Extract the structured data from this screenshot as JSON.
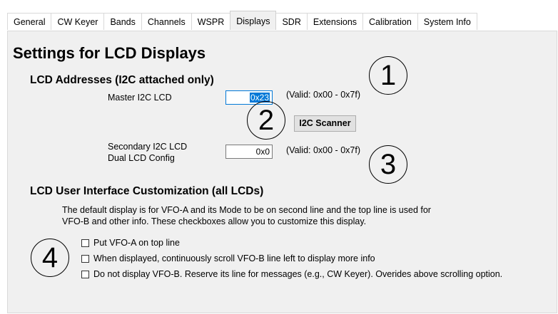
{
  "tabs": [
    "General",
    "CW Keyer",
    "Bands",
    "Channels",
    "WSPR",
    "Displays",
    "SDR",
    "Extensions",
    "Calibration",
    "System Info"
  ],
  "active_tab": "Displays",
  "page_title": "Settings for LCD Displays",
  "addresses": {
    "title": "LCD Addresses (I2C attached only)",
    "master_label": "Master I2C LCD",
    "master_value": "0x23",
    "master_valid": "(Valid: 0x00 - 0x7f)",
    "scanner_button": "I2C Scanner",
    "secondary_label_1": "Secondary I2C LCD",
    "secondary_label_2": "Dual LCD Config",
    "secondary_value": "0x0",
    "secondary_valid": "(Valid: 0x00 - 0x7f)"
  },
  "customization": {
    "title": "LCD User Interface Customization (all LCDs)",
    "desc_line1": "The default display is for VFO-A and its Mode to be on second line and the top line is used for",
    "desc_line2": "VFO-B and other info.  These checkboxes allow you to customize this display.",
    "options": [
      {
        "label": "Put VFO-A on top line",
        "checked": false
      },
      {
        "label": "When displayed, continuously scroll VFO-B line left to display more info",
        "checked": false
      },
      {
        "label": "Do not display VFO-B.  Reserve its line for messages (e.g., CW Keyer).  Overides above scrolling option.",
        "checked": false
      }
    ]
  },
  "markers": [
    "1",
    "2",
    "3",
    "4"
  ]
}
